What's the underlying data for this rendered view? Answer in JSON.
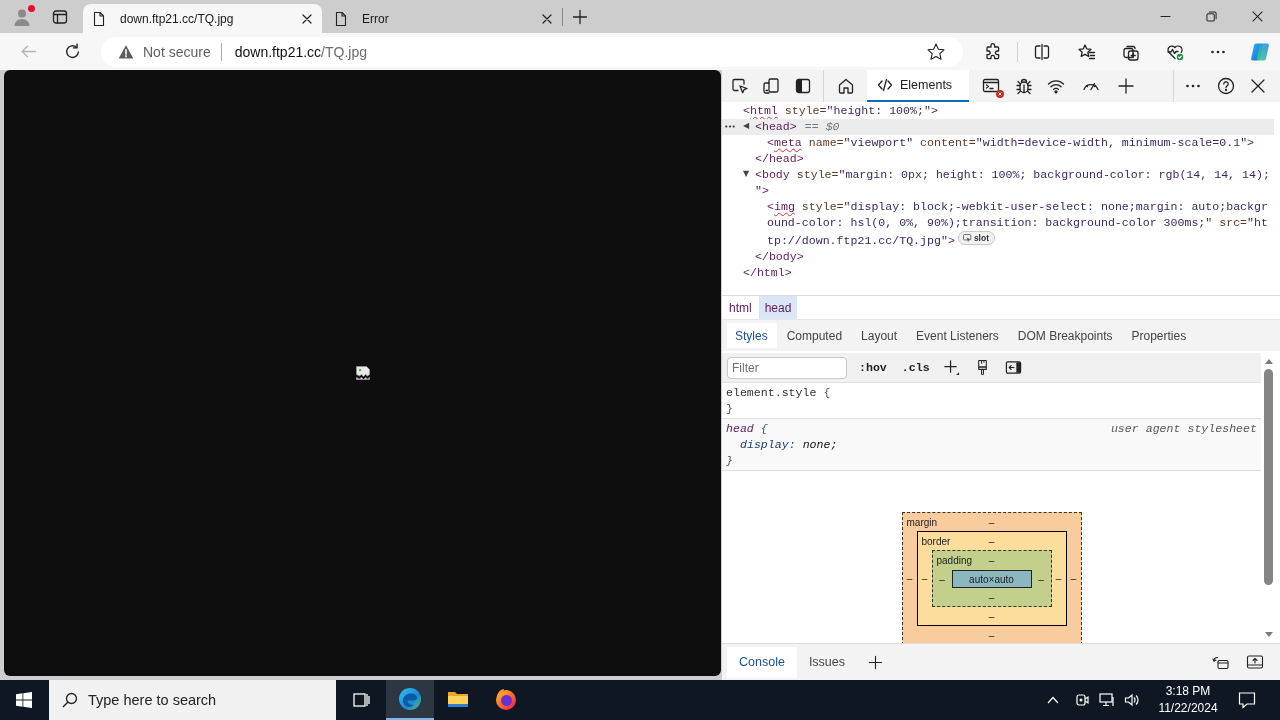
{
  "browser": {
    "profile": {
      "notification": true
    },
    "tabs": [
      {
        "title": "down.ftp21.cc/TQ.jpg",
        "selected": true
      },
      {
        "title": "Error",
        "selected": false
      }
    ],
    "back_button": {
      "disabled": true
    },
    "address": {
      "security": "Not secure",
      "host": "down.ftp21.cc",
      "path": "/TQ.jpg"
    }
  },
  "devtools": {
    "main_tab": {
      "label": "Elements",
      "selected": true
    },
    "console_error": true,
    "dom_tree": [
      {
        "selected": false,
        "lines": [
          [
            {
              "kind": "tag",
              "text": "<"
            },
            {
              "kind": "flagged",
              "text": "html"
            },
            {
              "kind": "attr",
              "text": " style="
            },
            {
              "kind": "value",
              "text": "\"height: 100%;\""
            },
            {
              "kind": "tag",
              "text": ">"
            }
          ]
        ],
        "children": [
          {
            "toggle": "◀",
            "selected": true,
            "lines": [
              [
                {
                  "kind": "tag",
                  "text": "<head>"
                }
              ]
            ],
            "ref": "== *$0*",
            "children": [
              {
                "selected": false,
                "lines": [
                  [
                    {
                      "kind": "tag",
                      "text": "<"
                    },
                    {
                      "kind": "flagged",
                      "text": "meta"
                    },
                    {
                      "kind": "attr",
                      "text": " name="
                    },
                    {
                      "kind": "value",
                      "text": "\"viewport\""
                    },
                    {
                      "kind": "attr",
                      "text": " content="
                    },
                    {
                      "kind": "value",
                      "text": "\"width=device-width, minimum-scale=0.1\""
                    },
                    {
                      "kind": "tag",
                      "text": ">"
                    }
                  ]
                ]
              }
            ],
            "closing": "</head>"
          },
          {
            "toggle": "▼",
            "selected": false,
            "lines": [
              [
                {
                  "kind": "tag",
                  "text": "<body"
                },
                {
                  "kind": "attr",
                  "text": " style="
                },
                {
                  "kind": "value",
                  "text": "\"margin: 0px; height: 100%; background-color: rgb(14, 14, 14);"
                }
              ],
              [
                {
                  "kind": "value",
                  "text": "\""
                },
                {
                  "kind": "tag",
                  "text": ">"
                }
              ]
            ],
            "children": [
              {
                "selected": false,
                "lines": [
                  [
                    {
                      "kind": "tag",
                      "text": "<"
                    },
                    {
                      "kind": "flagged",
                      "text": "img"
                    },
                    {
                      "kind": "attr",
                      "text": " style="
                    },
                    {
                      "kind": "value",
                      "text": "\"display: block;-webkit-user-select: none;margin: auto;backgr"
                    }
                  ],
                  [
                    {
                      "kind": "value",
                      "text": "ound-color: hsl(0, 0%, 90%);transition: background-color 300ms;\""
                    },
                    {
                      "kind": "attr",
                      "text": " src="
                    },
                    {
                      "kind": "value",
                      "text": "\"ht"
                    }
                  ],
                  [
                    {
                      "kind": "value",
                      "text": "tp://down.ftp21.cc/TQ.jpg\""
                    },
                    {
                      "kind": "tag",
                      "text": ">"
                    }
                  ]
                ],
                "badge": "slot"
              }
            ],
            "closing": "</body>"
          }
        ],
        "closing": "</html>"
      }
    ],
    "breadcrumbs": [
      {
        "label": "html",
        "selected": false
      },
      {
        "label": "head",
        "selected": true
      }
    ],
    "sidebar_tabs": [
      {
        "label": "Styles",
        "selected": true
      },
      {
        "label": "Computed",
        "selected": false
      },
      {
        "label": "Layout",
        "selected": false
      },
      {
        "label": "Event Listeners",
        "selected": false
      },
      {
        "label": "DOM Breakpoints",
        "selected": false
      },
      {
        "label": "Properties",
        "selected": false
      }
    ],
    "filter": {
      "placeholder": "Filter"
    },
    "style_toggles": [
      ":hov",
      ".cls"
    ],
    "rules": [
      {
        "kind": "inline",
        "selector": "element.style",
        "open": "{",
        "close": "}"
      },
      {
        "kind": "user-agent",
        "selector": "head",
        "open": "{",
        "origin": "user agent stylesheet",
        "declarations": [
          {
            "property": "display:",
            "value": "none;"
          }
        ],
        "close": "}"
      }
    ],
    "box_model": {
      "layers": [
        {
          "kind": "margin",
          "label": "margin",
          "top": "–"
        },
        {
          "kind": "border",
          "label": "border",
          "top": "–"
        },
        {
          "kind": "padding",
          "label": "padding",
          "top": "–"
        }
      ],
      "left_values": [
        "–",
        "–",
        "–"
      ],
      "content": "auto×auto",
      "right_values": [
        "–",
        "–",
        "–"
      ],
      "bottom_values": [
        "–",
        "–",
        "–"
      ]
    },
    "drawer_tabs": [
      {
        "label": "Console",
        "selected": true
      },
      {
        "label": "Issues",
        "selected": false
      }
    ]
  },
  "taskbar": {
    "search_placeholder": "Type here to search",
    "apps": [
      {
        "active": true
      },
      {
        "active": false
      },
      {
        "active": false
      }
    ],
    "time": "3:18 PM",
    "date": "11/22/2024"
  }
}
